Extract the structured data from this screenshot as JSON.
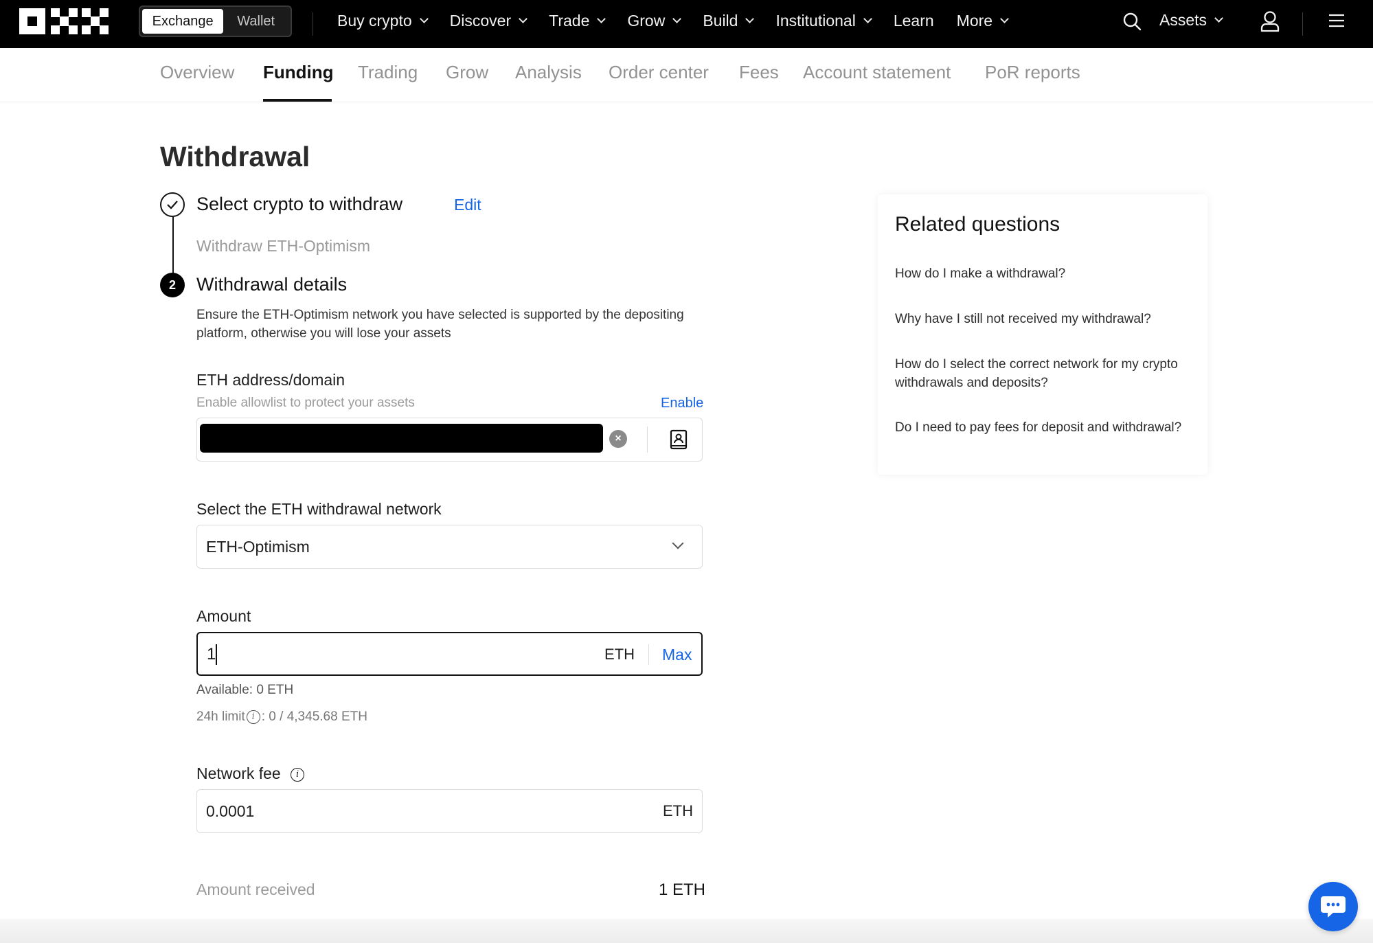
{
  "header": {
    "segment": {
      "exchange": "Exchange",
      "wallet": "Wallet"
    },
    "nav": [
      "Buy crypto",
      "Discover",
      "Trade",
      "Grow",
      "Build",
      "Institutional",
      "Learn",
      "More"
    ],
    "assets_label": "Assets"
  },
  "subtabs": {
    "overview": "Overview",
    "funding": "Funding",
    "trading": "Trading",
    "grow": "Grow",
    "analysis": "Analysis",
    "order_center": "Order center",
    "fees": "Fees",
    "account_statement": "Account statement",
    "por_reports": "PoR reports"
  },
  "page": {
    "title": "Withdrawal",
    "step1": {
      "title": "Select crypto to withdraw",
      "edit": "Edit",
      "subtitle": "Withdraw ETH-Optimism"
    },
    "step2": {
      "number": "2",
      "title": "Withdrawal details",
      "description": "Ensure the ETH-Optimism network you have selected is supported by the depositing platform, otherwise you will lose your assets"
    },
    "address": {
      "label": "ETH address/domain",
      "hint": "Enable allowlist to protect your assets",
      "enable": "Enable"
    },
    "network": {
      "label": "Select the ETH withdrawal network",
      "value": "ETH-Optimism"
    },
    "amount": {
      "label": "Amount",
      "value": "1",
      "unit": "ETH",
      "max": "Max",
      "available": "Available: 0 ETH",
      "limit_label": "24h limit",
      "limit_value": ": 0 / 4,345.68 ETH"
    },
    "fee": {
      "label": "Network fee",
      "value": "0.0001",
      "unit": "ETH"
    },
    "received": {
      "label": "Amount received",
      "value": "1 ETH"
    }
  },
  "related": {
    "title": "Related questions",
    "questions": [
      "How do I make a withdrawal?",
      "Why have I still not received my withdrawal?",
      "How do I select the correct network for my crypto withdrawals and deposits?",
      "Do I need to pay fees for deposit and withdrawal?"
    ]
  },
  "colors": {
    "accent": "#1565e6",
    "topbar": "#000000"
  }
}
